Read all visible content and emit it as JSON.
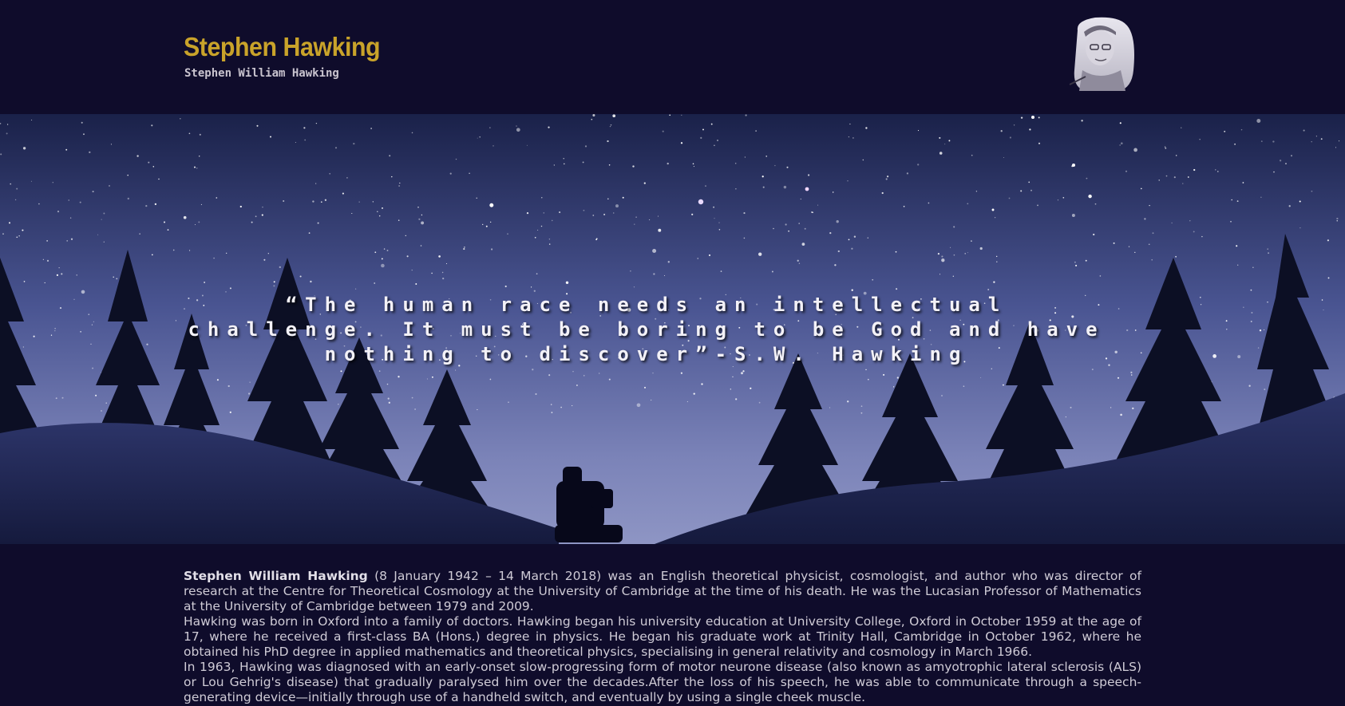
{
  "header": {
    "title": "Stephen Hawking",
    "subtitle": "Stephen William Hawking",
    "portrait_icon": "stephen-hawking-portrait"
  },
  "hero": {
    "quote": "“The human race needs an intellectual challenge. It must be boring to be God and have nothing to discover”-S.W. Hawking"
  },
  "biography": {
    "name_bold": "Stephen William Hawking",
    "p1_rest": " (8 January 1942 – 14 March 2018) was an English theoretical physicist, cosmologist, and author who was director of research at the Centre for Theoretical Cosmology at the University of Cambridge at the time of his death. He was the Lucasian Professor of Mathematics at the University of Cambridge between 1979 and 2009.",
    "p2": "Hawking was born in Oxford into a family of doctors. Hawking began his university education at University College, Oxford in October 1959 at the age of 17, where he received a first-class BA (Hons.) degree in physics. He began his graduate work at Trinity Hall, Cambridge in October 1962, where he obtained his PhD degree in applied mathematics and theoretical physics, specialising in general relativity and cosmology in March 1966.",
    "p3": "In 1963, Hawking was diagnosed with an early-onset slow-progressing form of motor neurone disease (also known as amyotrophic lateral sclerosis (ALS) or Lou Gehrig's disease) that gradually paralysed him over the decades.After the loss of his speech, he was able to communicate through a speech-generating device—initially through use of a handheld switch, and eventually by using a single cheek muscle."
  },
  "colors": {
    "background": "#0f0c2b",
    "title": "#c9a32a",
    "body_text": "#cfcbd6"
  }
}
